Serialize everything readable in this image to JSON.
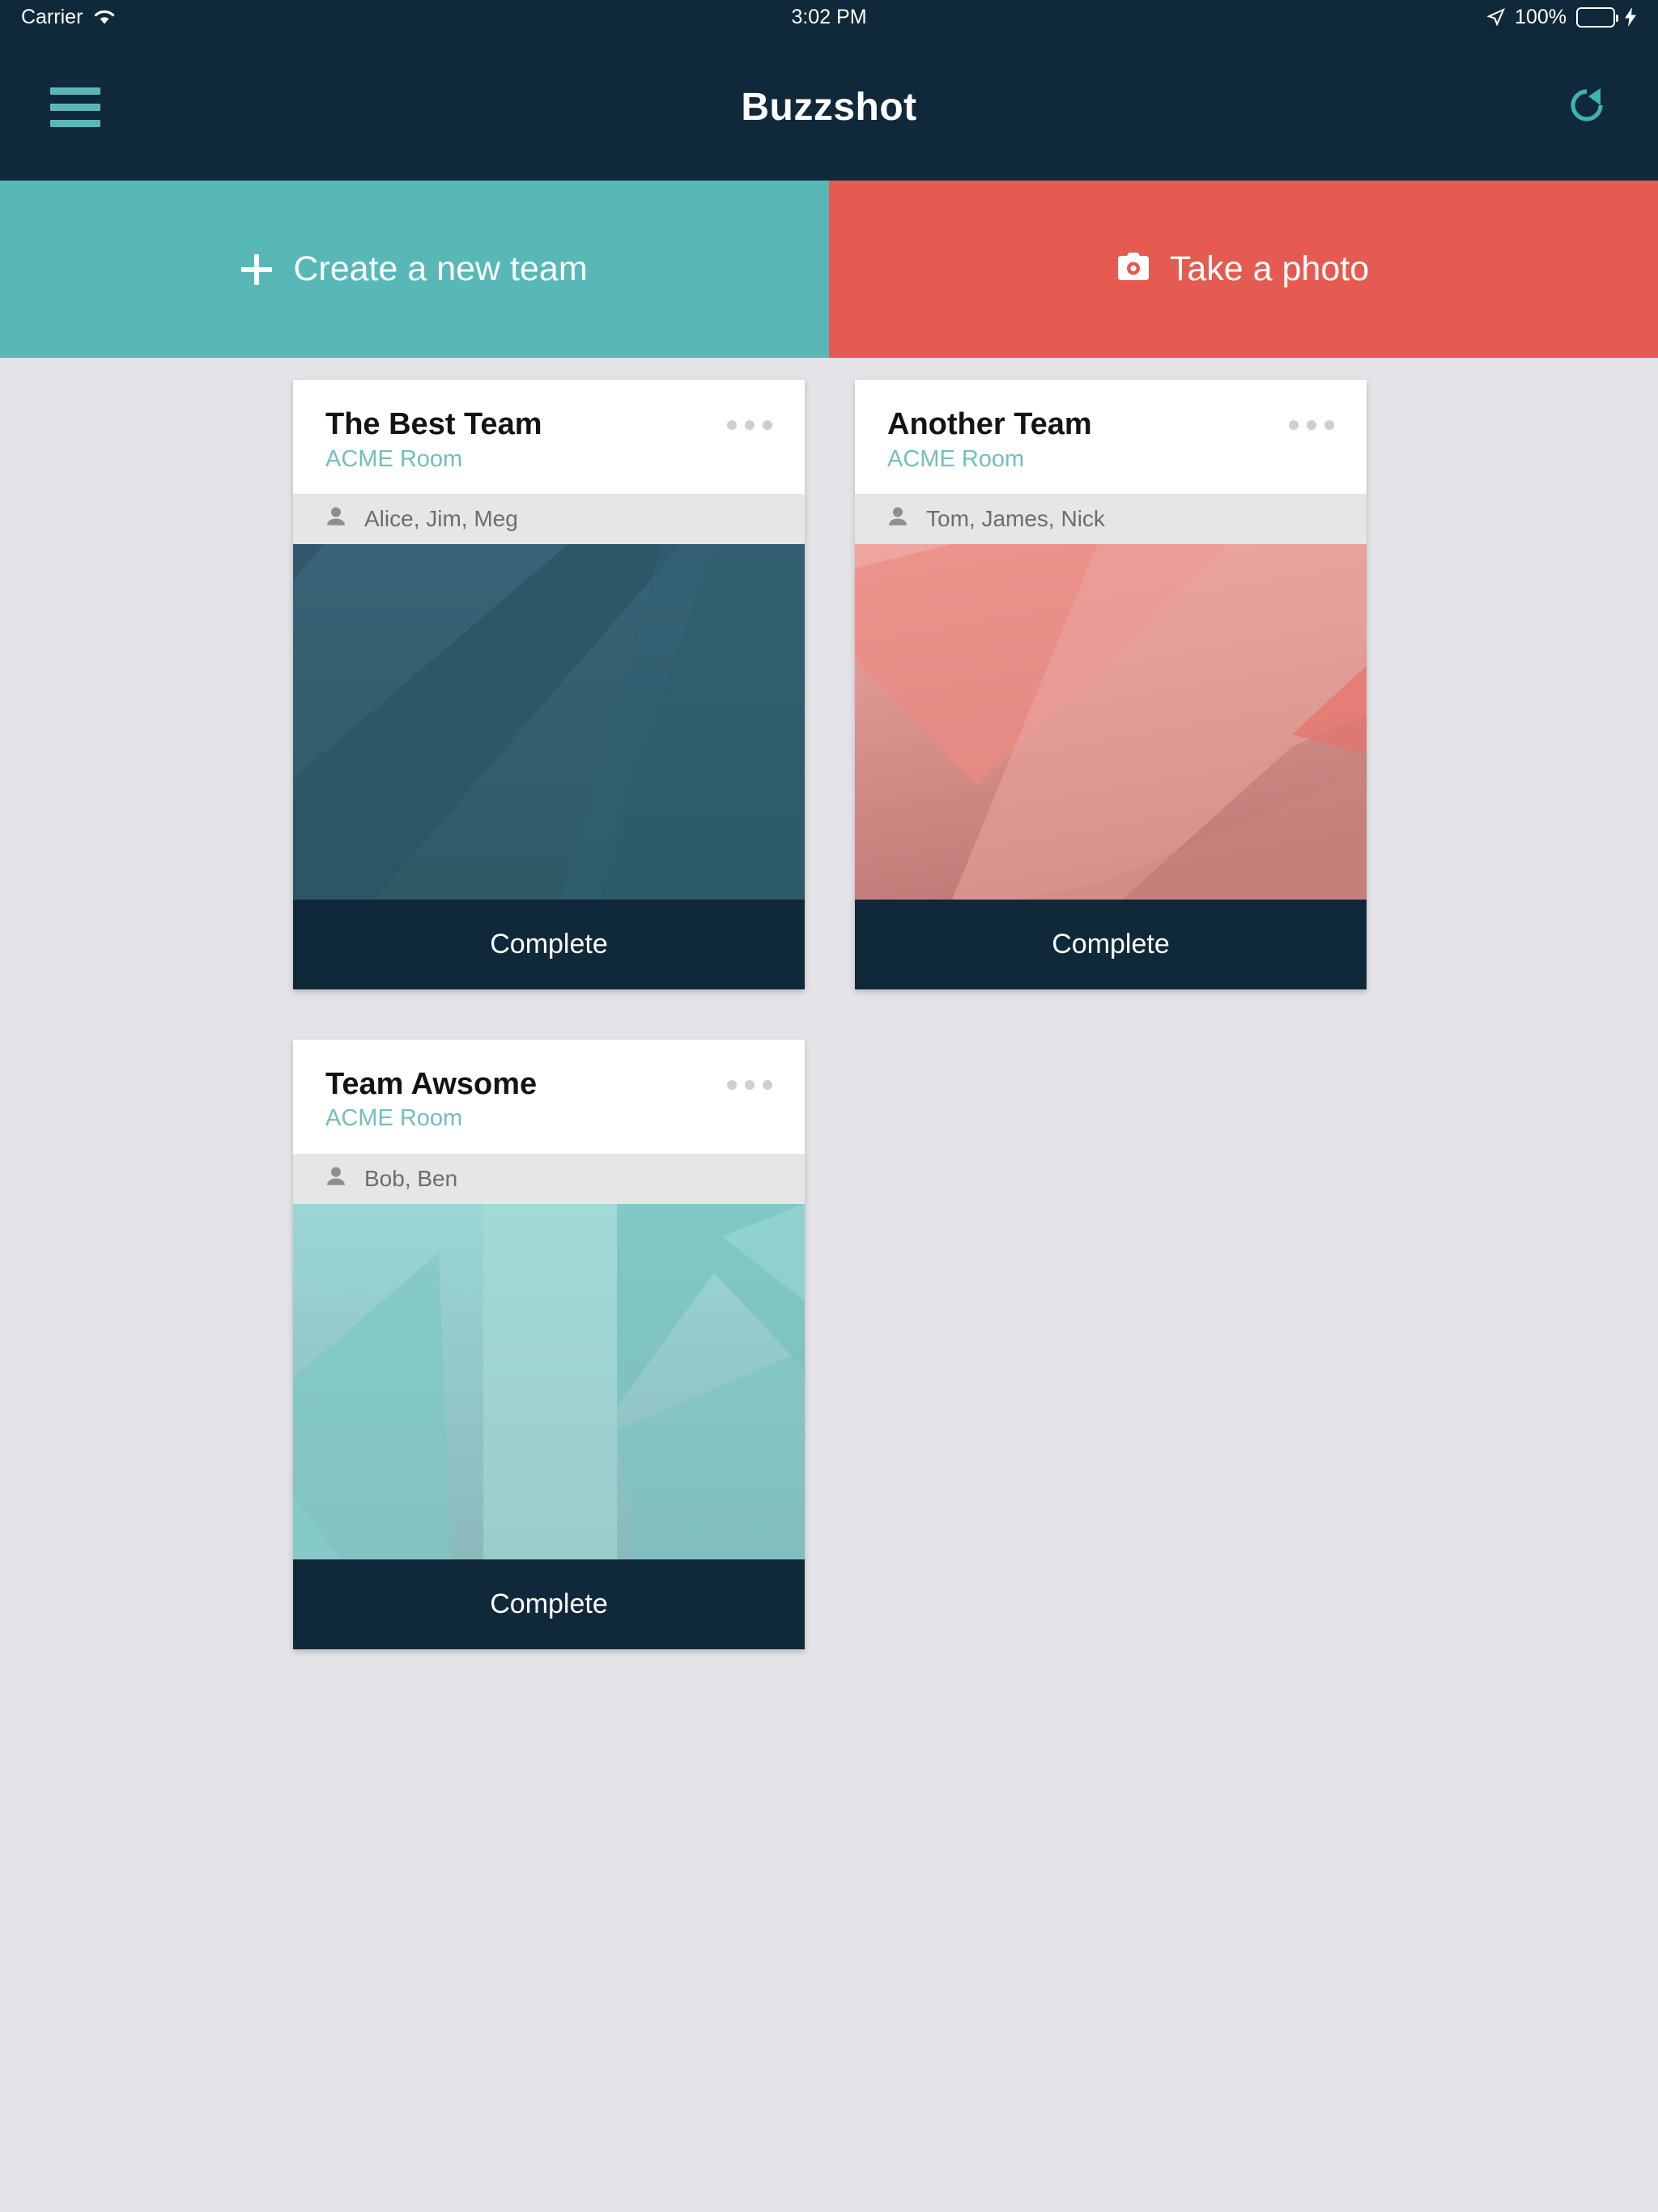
{
  "status_bar": {
    "carrier": "Carrier",
    "wifi_icon": "wifi-icon",
    "time": "3:02 PM",
    "location_icon": "location-arrow-icon",
    "battery_percent": "100%",
    "battery_level": 100,
    "charging_icon": "lightning-bolt-icon"
  },
  "nav_bar": {
    "menu_icon": "hamburger-menu-icon",
    "title": "Buzzshot",
    "refresh_icon": "refresh-icon",
    "background": "#10293a",
    "accent": "#5bb7b7"
  },
  "action_bar": {
    "create": {
      "label": "Create a new team",
      "icon": "plus-icon",
      "color": "#58b8b8"
    },
    "photo": {
      "label": "Take a photo",
      "icon": "camera-icon",
      "color": "#e55b51"
    }
  },
  "cards": [
    {
      "title": "The Best Team",
      "room": "ACME Room",
      "members": "Alice, Jim, Meg",
      "member_icon": "person-icon",
      "menu_icon": "overflow-menu-icon",
      "photo_placeholder_icon": "camera-placeholder-icon",
      "footer_label": "Complete",
      "theme": "blue"
    },
    {
      "title": "Another Team",
      "room": "ACME Room",
      "members": "Tom, James, Nick",
      "member_icon": "person-icon",
      "menu_icon": "overflow-menu-icon",
      "photo_placeholder_icon": "camera-placeholder-icon",
      "footer_label": "Complete",
      "theme": "red"
    },
    {
      "title": "Team Awsome",
      "room": "ACME Room",
      "members": "Bob, Ben",
      "member_icon": "person-icon",
      "menu_icon": "overflow-menu-icon",
      "photo_placeholder_icon": "camera-placeholder-icon",
      "footer_label": "Complete",
      "theme": "teal"
    }
  ],
  "colors": {
    "page_background": "#e3e3e8",
    "card_background": "#ffffff",
    "member_row": "#e6e6e6",
    "room_text": "#72bfbc",
    "footer": "#10293a"
  }
}
